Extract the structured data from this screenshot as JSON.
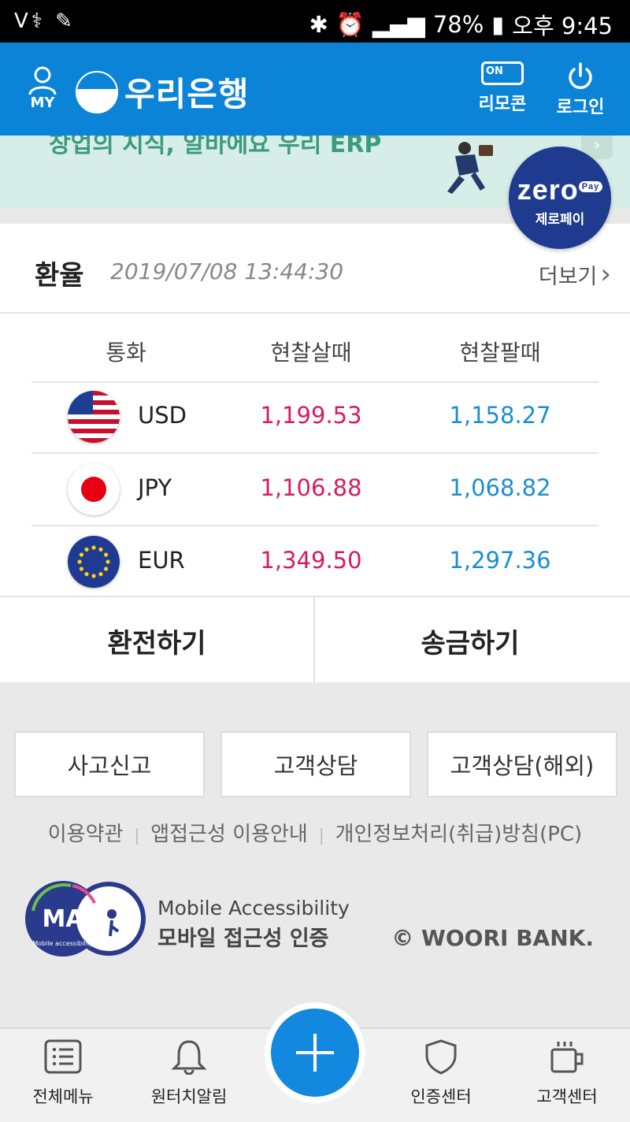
{
  "status_bar": {
    "left_icons": "V⚕ ✎",
    "battery": "78%",
    "time": "오후 9:45"
  },
  "header": {
    "my_label": "MY",
    "bank_name": "우리은행",
    "remocon_toggle": "ON",
    "remocon_label": "리모콘",
    "login_label": "로그인"
  },
  "banner": {
    "text": "창업의 지식, 알바에요 우리 ERP"
  },
  "zeropay": {
    "brand": "zero",
    "pay_tag": "Pay",
    "label": "제로페이"
  },
  "exchange": {
    "title": "환율",
    "timestamp": "2019/07/08 13:44:30",
    "more_label": "더보기",
    "columns": [
      "통화",
      "현찰살때",
      "현찰팔때"
    ],
    "rows": [
      {
        "currency": "USD",
        "buy": "1,199.53",
        "sell": "1,158.27"
      },
      {
        "currency": "JPY",
        "buy": "1,106.88",
        "sell": "1,068.82"
      },
      {
        "currency": "EUR",
        "buy": "1,349.50",
        "sell": "1,297.36"
      }
    ],
    "exchange_button": "환전하기",
    "remit_button": "송금하기"
  },
  "service_buttons": [
    "사고신고",
    "고객상담",
    "고객상담(해외)"
  ],
  "footer_links": [
    "이용약관",
    "앱접근성 이용안내",
    "개인정보처리(취급)방침(PC)"
  ],
  "accessibility": {
    "badge_text": "MA",
    "badge_caption": "Mobile accessibility",
    "en": "Mobile Accessibility",
    "ko": "모바일 접근성 인증"
  },
  "copyright": "© WOORI BANK.",
  "tabs": [
    "전체메뉴",
    "원터치알림",
    "인증센터",
    "고객센터"
  ],
  "colors": {
    "header_blue": "#0b84d8",
    "buy_red": "#d81b60",
    "sell_blue": "#1a8fd0",
    "zeropay_navy": "#1e3b8f"
  }
}
